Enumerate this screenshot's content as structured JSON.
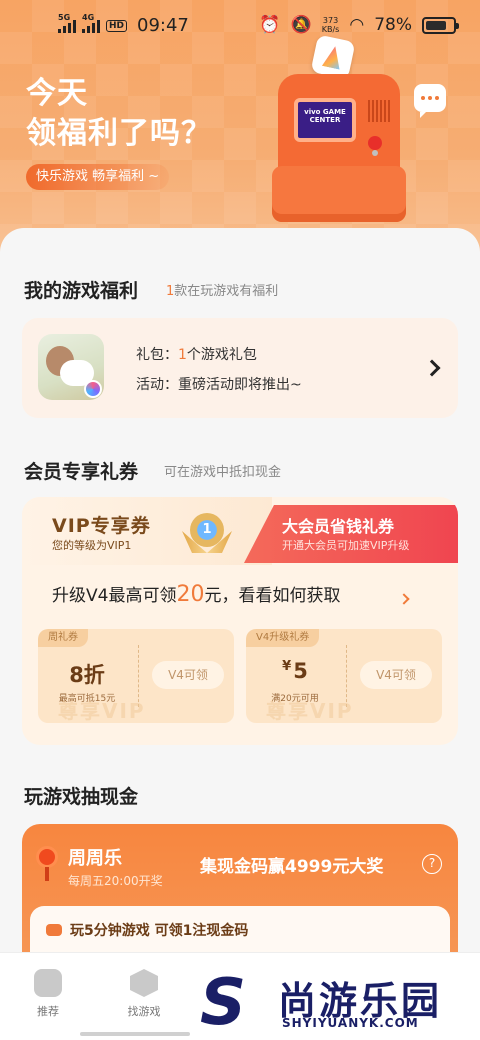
{
  "status_bar": {
    "sim1": "5G",
    "sim2": "4G",
    "hd": "HD",
    "time": "09:47",
    "net_speed": "373",
    "net_unit": "KB/s",
    "battery": "78%",
    "battery_level": 0.78
  },
  "hero": {
    "title_line1": "今天",
    "title_line2": "领福利了吗？",
    "tagline": "快乐游戏  畅享福利 ~",
    "machine_text": "vivo GAME CENTER",
    "chat_icon": "chat-bubble-icon"
  },
  "my_welfare": {
    "title": "我的游戏福利",
    "count": "1",
    "count_suffix": "款在玩游戏有福利",
    "gift_label": "礼包：",
    "gift_count": "1",
    "gift_suffix": "个游戏礼包",
    "activity_label": "活动：",
    "activity_text": "重磅活动即将推出~"
  },
  "member": {
    "title": "会员专享礼券",
    "subtitle": "可在游戏中抵扣现金",
    "vip_title": "VIP专享券",
    "vip_level": "您的等级为VIP1",
    "medal_number": "1",
    "promo_title": "大会员省钱礼券",
    "promo_sub": "开通大会员可加速VIP升级",
    "upgrade_prefix": "升级V4最高可领",
    "upgrade_amount": "20",
    "upgrade_suffix": "元，看看如何获取",
    "coupons": [
      {
        "tag": "周礼券",
        "value": "8折",
        "note": "最高可抵15元",
        "action": "V4可领"
      },
      {
        "tag": "V4升级礼券",
        "currency": "¥",
        "value": "5",
        "note": "满20元可用",
        "action": "V4可领"
      }
    ],
    "watermark": "尊享VIP"
  },
  "cash": {
    "title": "玩游戏抽现金",
    "event_name": "周周乐",
    "event_time": "每周五20:00开奖",
    "slogan": "集现金码赢4999元大奖",
    "help": "?",
    "task": "玩5分钟游戏 可领1注现金码"
  },
  "bottom_nav": [
    {
      "label": "推荐",
      "icon": "gamepad-icon"
    },
    {
      "label": "找游戏",
      "icon": "discover-icon"
    }
  ],
  "watermark": {
    "cn": "尚游乐园",
    "en": "SHYIYUANYK.COM"
  },
  "colors": {
    "accent": "#f07a3a",
    "hero_bg": "#f7a463",
    "vip_red": "#f04550"
  }
}
